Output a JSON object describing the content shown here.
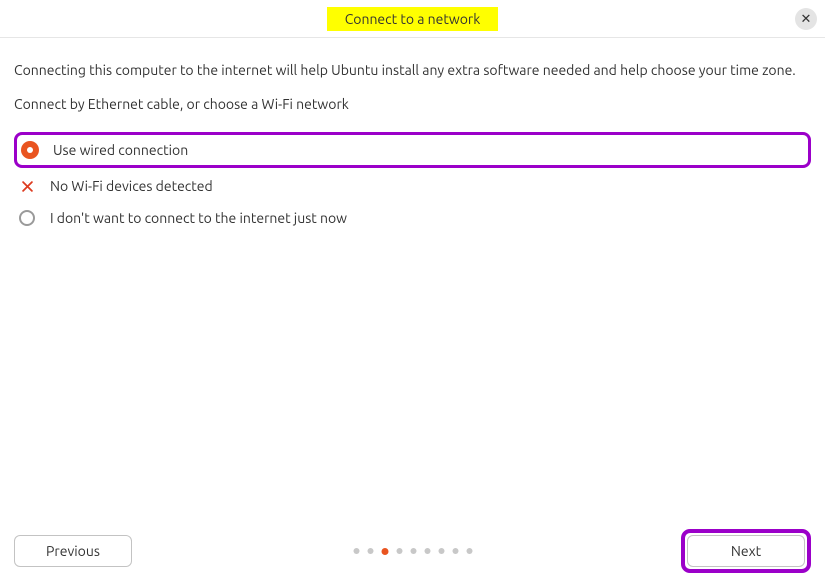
{
  "header": {
    "title": "Connect to a network"
  },
  "intro": "Connecting this computer to the internet will help Ubuntu install any extra software needed and help choose your time zone.",
  "subintro": "Connect by Ethernet cable, or choose a Wi-Fi network",
  "options": {
    "wired": "Use wired connection",
    "nowifi": "No Wi-Fi devices detected",
    "noconnect": "I don't want to connect to the internet just now"
  },
  "nav": {
    "previous": "Previous",
    "next": "Next"
  },
  "progress": {
    "total": 9,
    "current": 3
  },
  "colors": {
    "accent": "#e95420",
    "highlight": "#9b00c9",
    "title_bg": "#ffff00"
  }
}
